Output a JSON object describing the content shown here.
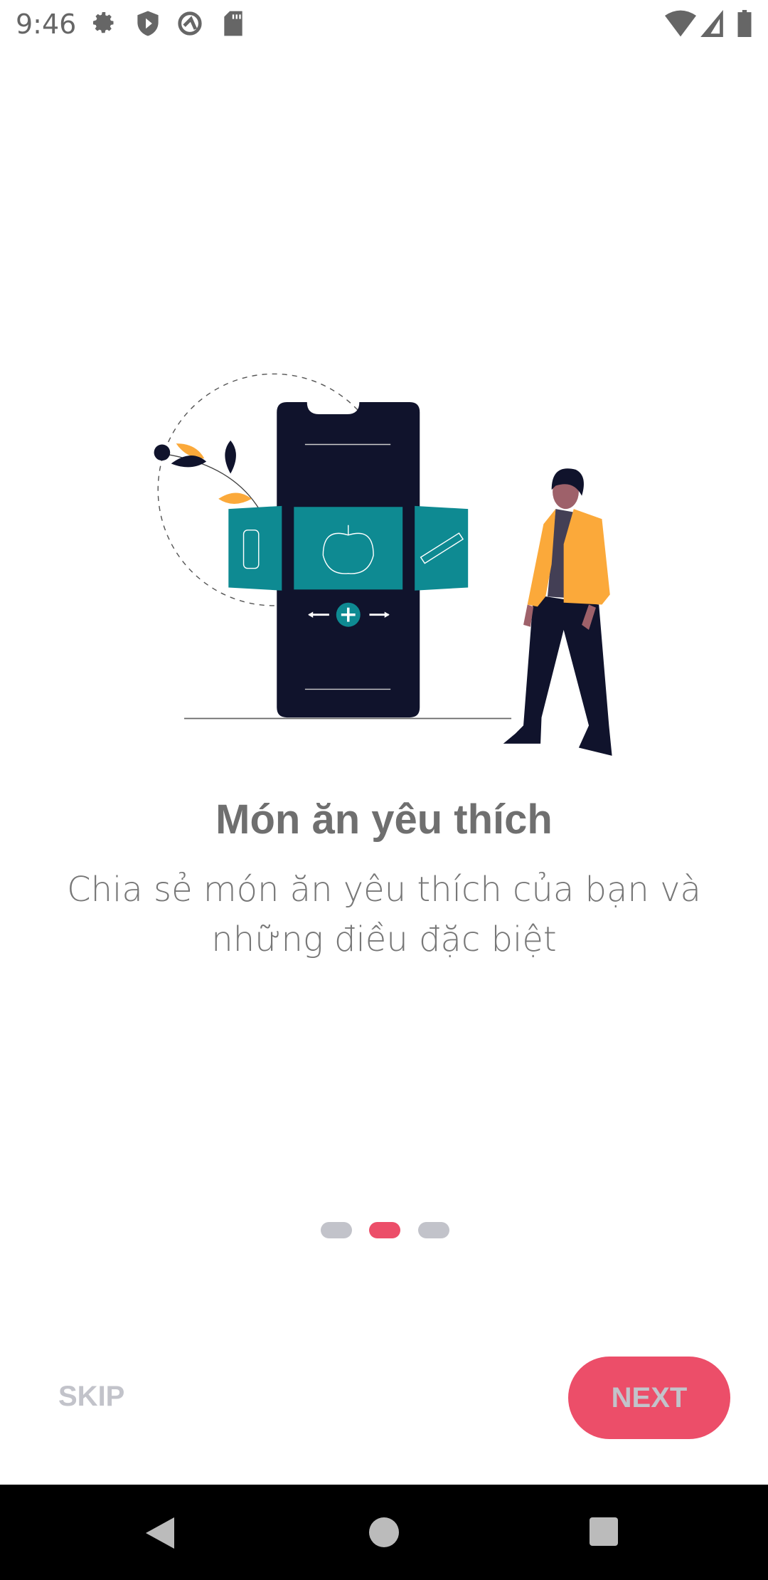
{
  "status_bar": {
    "time": "9:46",
    "icons": [
      "gear-icon",
      "shield-play-icon",
      "no-sync-icon",
      "sd-card-icon",
      "wifi-icon",
      "signal-icon",
      "battery-icon"
    ]
  },
  "onboarding": {
    "title": "Món ăn yêu thích",
    "subtitle": "Chia sẻ món ăn yêu thích của bạn và những điều đặc biệt",
    "page_index": 2,
    "page_count": 3
  },
  "buttons": {
    "skip": "SKIP",
    "next": "NEXT"
  },
  "colors": {
    "accent": "#EC4E69",
    "inactive": "#C2C3CA",
    "teal": "#0E8A92",
    "navy": "#10132C",
    "orange": "#FBA93A"
  },
  "nav_bar": {
    "icons": [
      "back-icon",
      "home-icon",
      "recents-icon"
    ]
  }
}
